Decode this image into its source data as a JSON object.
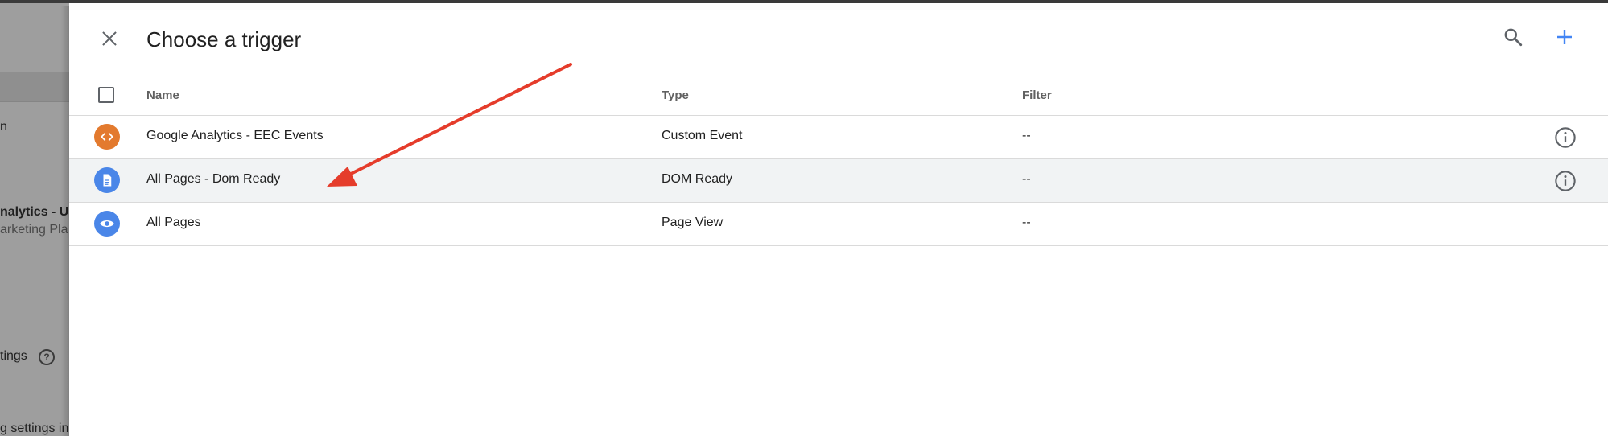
{
  "background": {
    "partial_texts": [
      "n",
      "nalytics - U",
      "arketing Pla",
      "tings",
      "g settings in"
    ]
  },
  "dialog": {
    "title": "Choose a trigger",
    "close_icon": "close-icon",
    "search_icon": "search-icon",
    "add_icon": "plus-icon",
    "accent_color": "#4285f4"
  },
  "table": {
    "columns": [
      "Name",
      "Type",
      "Filter"
    ],
    "rows": [
      {
        "name": "Google Analytics - EEC Events",
        "type": "Custom Event",
        "filter": "--",
        "icon": "code-icon",
        "icon_color": "#e37a2e",
        "has_info": true
      },
      {
        "name": "All Pages - Dom Ready",
        "type": "DOM Ready",
        "filter": "--",
        "icon": "document-icon",
        "icon_color": "#4a86e8",
        "has_info": true,
        "highlighted": true
      },
      {
        "name": "All Pages",
        "type": "Page View",
        "filter": "--",
        "icon": "eye-icon",
        "icon_color": "#4a86e8",
        "has_info": false
      }
    ]
  },
  "annotation": {
    "arrow_color": "#e53c2b"
  }
}
